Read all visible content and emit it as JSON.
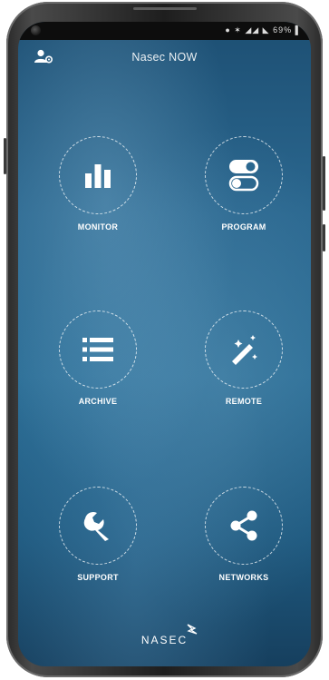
{
  "status_bar": {
    "icons_text": "● ✶ ◢◢ ◣ 69% ▌"
  },
  "header": {
    "title": "Nasec NOW",
    "user_icon": "user-settings-icon"
  },
  "tiles": [
    {
      "label": "MONITOR",
      "icon": "bar-chart-icon"
    },
    {
      "label": "PROGRAM",
      "icon": "toggle-switches-icon"
    },
    {
      "label": "ARCHIVE",
      "icon": "list-icon"
    },
    {
      "label": "REMOTE",
      "icon": "magic-wand-icon"
    },
    {
      "label": "SUPPORT",
      "icon": "wrench-icon"
    },
    {
      "label": "NETWORKS",
      "icon": "share-icon"
    }
  ],
  "footer": {
    "logo_text": "NASEC"
  },
  "colors": {
    "ring": "#ffffff",
    "background": "#2b6890",
    "frame": "#2b2b2b"
  }
}
